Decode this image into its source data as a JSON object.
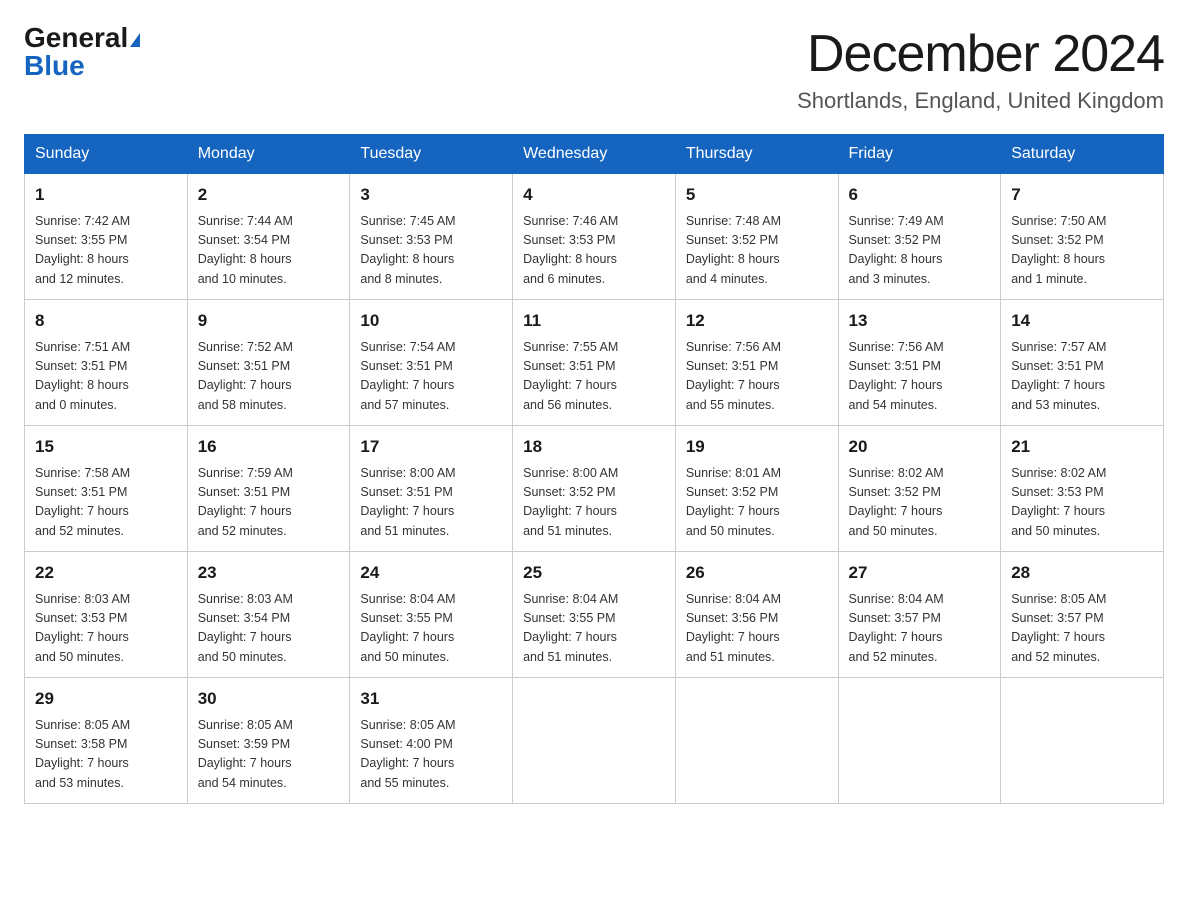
{
  "header": {
    "logo_general": "General",
    "logo_blue": "Blue",
    "month_title": "December 2024",
    "location": "Shortlands, England, United Kingdom"
  },
  "weekdays": [
    "Sunday",
    "Monday",
    "Tuesday",
    "Wednesday",
    "Thursday",
    "Friday",
    "Saturday"
  ],
  "weeks": [
    [
      {
        "day": "1",
        "sunrise": "7:42 AM",
        "sunset": "3:55 PM",
        "daylight": "8 hours and 12 minutes."
      },
      {
        "day": "2",
        "sunrise": "7:44 AM",
        "sunset": "3:54 PM",
        "daylight": "8 hours and 10 minutes."
      },
      {
        "day": "3",
        "sunrise": "7:45 AM",
        "sunset": "3:53 PM",
        "daylight": "8 hours and 8 minutes."
      },
      {
        "day": "4",
        "sunrise": "7:46 AM",
        "sunset": "3:53 PM",
        "daylight": "8 hours and 6 minutes."
      },
      {
        "day": "5",
        "sunrise": "7:48 AM",
        "sunset": "3:52 PM",
        "daylight": "8 hours and 4 minutes."
      },
      {
        "day": "6",
        "sunrise": "7:49 AM",
        "sunset": "3:52 PM",
        "daylight": "8 hours and 3 minutes."
      },
      {
        "day": "7",
        "sunrise": "7:50 AM",
        "sunset": "3:52 PM",
        "daylight": "8 hours and 1 minute."
      }
    ],
    [
      {
        "day": "8",
        "sunrise": "7:51 AM",
        "sunset": "3:51 PM",
        "daylight": "8 hours and 0 minutes."
      },
      {
        "day": "9",
        "sunrise": "7:52 AM",
        "sunset": "3:51 PM",
        "daylight": "7 hours and 58 minutes."
      },
      {
        "day": "10",
        "sunrise": "7:54 AM",
        "sunset": "3:51 PM",
        "daylight": "7 hours and 57 minutes."
      },
      {
        "day": "11",
        "sunrise": "7:55 AM",
        "sunset": "3:51 PM",
        "daylight": "7 hours and 56 minutes."
      },
      {
        "day": "12",
        "sunrise": "7:56 AM",
        "sunset": "3:51 PM",
        "daylight": "7 hours and 55 minutes."
      },
      {
        "day": "13",
        "sunrise": "7:56 AM",
        "sunset": "3:51 PM",
        "daylight": "7 hours and 54 minutes."
      },
      {
        "day": "14",
        "sunrise": "7:57 AM",
        "sunset": "3:51 PM",
        "daylight": "7 hours and 53 minutes."
      }
    ],
    [
      {
        "day": "15",
        "sunrise": "7:58 AM",
        "sunset": "3:51 PM",
        "daylight": "7 hours and 52 minutes."
      },
      {
        "day": "16",
        "sunrise": "7:59 AM",
        "sunset": "3:51 PM",
        "daylight": "7 hours and 52 minutes."
      },
      {
        "day": "17",
        "sunrise": "8:00 AM",
        "sunset": "3:51 PM",
        "daylight": "7 hours and 51 minutes."
      },
      {
        "day": "18",
        "sunrise": "8:00 AM",
        "sunset": "3:52 PM",
        "daylight": "7 hours and 51 minutes."
      },
      {
        "day": "19",
        "sunrise": "8:01 AM",
        "sunset": "3:52 PM",
        "daylight": "7 hours and 50 minutes."
      },
      {
        "day": "20",
        "sunrise": "8:02 AM",
        "sunset": "3:52 PM",
        "daylight": "7 hours and 50 minutes."
      },
      {
        "day": "21",
        "sunrise": "8:02 AM",
        "sunset": "3:53 PM",
        "daylight": "7 hours and 50 minutes."
      }
    ],
    [
      {
        "day": "22",
        "sunrise": "8:03 AM",
        "sunset": "3:53 PM",
        "daylight": "7 hours and 50 minutes."
      },
      {
        "day": "23",
        "sunrise": "8:03 AM",
        "sunset": "3:54 PM",
        "daylight": "7 hours and 50 minutes."
      },
      {
        "day": "24",
        "sunrise": "8:04 AM",
        "sunset": "3:55 PM",
        "daylight": "7 hours and 50 minutes."
      },
      {
        "day": "25",
        "sunrise": "8:04 AM",
        "sunset": "3:55 PM",
        "daylight": "7 hours and 51 minutes."
      },
      {
        "day": "26",
        "sunrise": "8:04 AM",
        "sunset": "3:56 PM",
        "daylight": "7 hours and 51 minutes."
      },
      {
        "day": "27",
        "sunrise": "8:04 AM",
        "sunset": "3:57 PM",
        "daylight": "7 hours and 52 minutes."
      },
      {
        "day": "28",
        "sunrise": "8:05 AM",
        "sunset": "3:57 PM",
        "daylight": "7 hours and 52 minutes."
      }
    ],
    [
      {
        "day": "29",
        "sunrise": "8:05 AM",
        "sunset": "3:58 PM",
        "daylight": "7 hours and 53 minutes."
      },
      {
        "day": "30",
        "sunrise": "8:05 AM",
        "sunset": "3:59 PM",
        "daylight": "7 hours and 54 minutes."
      },
      {
        "day": "31",
        "sunrise": "8:05 AM",
        "sunset": "4:00 PM",
        "daylight": "7 hours and 55 minutes."
      },
      null,
      null,
      null,
      null
    ]
  ],
  "labels": {
    "sunrise": "Sunrise:",
    "sunset": "Sunset:",
    "daylight": "Daylight:"
  }
}
